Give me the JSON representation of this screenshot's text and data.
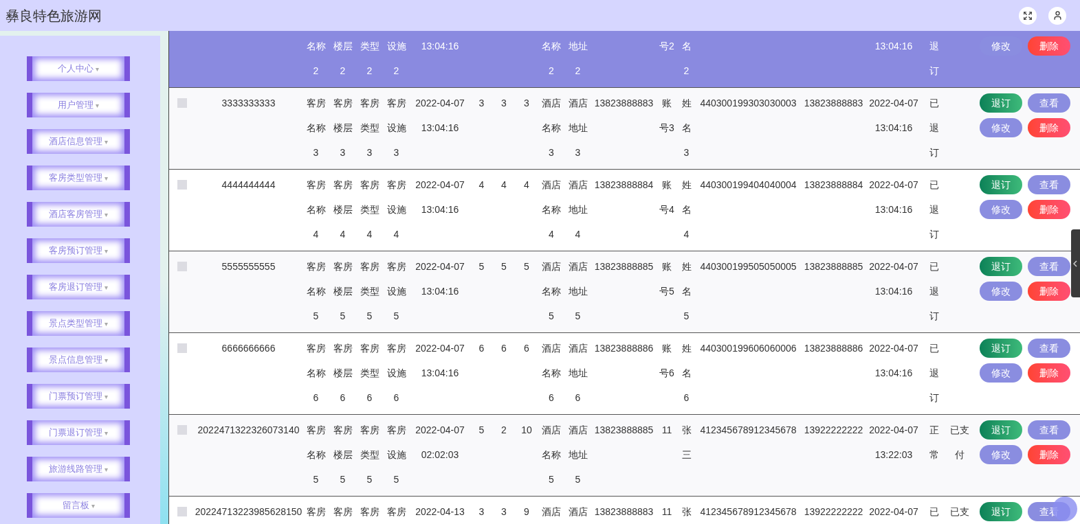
{
  "header": {
    "title": "彝良特色旅游网"
  },
  "sidebar": {
    "items": [
      {
        "label": "个人中心",
        "caret": "▾"
      },
      {
        "label": "用户管理",
        "caret": "▾"
      },
      {
        "label": "酒店信息管理",
        "caret": "▾"
      },
      {
        "label": "客房类型管理",
        "caret": "▾"
      },
      {
        "label": "酒店客房管理",
        "caret": "▾"
      },
      {
        "label": "客房预订管理",
        "caret": "▾"
      },
      {
        "label": "客房退订管理",
        "caret": "▾"
      },
      {
        "label": "景点类型管理",
        "caret": "▾"
      },
      {
        "label": "景点信息管理",
        "caret": "▾"
      },
      {
        "label": "门票预订管理",
        "caret": "▾"
      },
      {
        "label": "门票退订管理",
        "caret": "▾"
      },
      {
        "label": "旅游线路管理",
        "caret": "▾"
      },
      {
        "label": "留言板",
        "caret": "▾"
      }
    ]
  },
  "table": {
    "rows": [
      {
        "highlighted": true,
        "cells": {
          "column_3": "名称2",
          "column_4": "楼层2",
          "column_5": "类型2",
          "column_6": "设施2",
          "column_7": "13:04:16",
          "column_11": "名称2",
          "column_12": "地址2",
          "column_14": "号2",
          "column_15": "名2",
          "column_18": "13:04:16",
          "column_19": "退订"
        },
        "actions": [
          {
            "label": "修改",
            "kind": "edit"
          },
          {
            "label": "删除",
            "kind": "delete"
          }
        ]
      },
      {
        "highlighted": false,
        "checked": false,
        "cells": {
          "column_2": "3333333333",
          "column_3": "客房名称3",
          "column_4": "客房楼层3",
          "column_5": "客房类型3",
          "column_6": "客房设施3",
          "column_7": "2022-04-07 13:04:16",
          "column_8": "3",
          "column_9": "3",
          "column_10": "3",
          "column_11": "酒店名称3",
          "column_12": "酒店地址3",
          "column_13": "13823888883",
          "column_14": "账号3",
          "column_15": "姓名3",
          "column_16": "440300199303030003",
          "column_17": "13823888883",
          "column_18": "2022-04-07 13:04:16",
          "column_19": "已退订"
        },
        "actions": [
          {
            "label": "退订",
            "kind": "refund"
          },
          {
            "label": "查看",
            "kind": "view"
          },
          {
            "label": "修改",
            "kind": "edit"
          },
          {
            "label": "删除",
            "kind": "delete"
          }
        ]
      },
      {
        "highlighted": false,
        "checked": false,
        "cells": {
          "column_2": "4444444444",
          "column_3": "客房名称4",
          "column_4": "客房楼层4",
          "column_5": "客房类型4",
          "column_6": "客房设施4",
          "column_7": "2022-04-07 13:04:16",
          "column_8": "4",
          "column_9": "4",
          "column_10": "4",
          "column_11": "酒店名称4",
          "column_12": "酒店地址4",
          "column_13": "13823888884",
          "column_14": "账号4",
          "column_15": "姓名4",
          "column_16": "440300199404040004",
          "column_17": "13823888884",
          "column_18": "2022-04-07 13:04:16",
          "column_19": "已退订"
        },
        "actions": [
          {
            "label": "退订",
            "kind": "refund"
          },
          {
            "label": "查看",
            "kind": "view"
          },
          {
            "label": "修改",
            "kind": "edit"
          },
          {
            "label": "删除",
            "kind": "delete"
          }
        ]
      },
      {
        "highlighted": false,
        "checked": false,
        "cells": {
          "column_2": "5555555555",
          "column_3": "客房名称5",
          "column_4": "客房楼层5",
          "column_5": "客房类型5",
          "column_6": "客房设施5",
          "column_7": "2022-04-07 13:04:16",
          "column_8": "5",
          "column_9": "5",
          "column_10": "5",
          "column_11": "酒店名称5",
          "column_12": "酒店地址5",
          "column_13": "13823888885",
          "column_14": "账号5",
          "column_15": "姓名5",
          "column_16": "440300199505050005",
          "column_17": "13823888885",
          "column_18": "2022-04-07 13:04:16",
          "column_19": "已退订"
        },
        "actions": [
          {
            "label": "退订",
            "kind": "refund"
          },
          {
            "label": "查看",
            "kind": "view"
          },
          {
            "label": "修改",
            "kind": "edit"
          },
          {
            "label": "删除",
            "kind": "delete"
          }
        ]
      },
      {
        "highlighted": false,
        "checked": false,
        "cells": {
          "column_2": "6666666666",
          "column_3": "客房名称6",
          "column_4": "客房楼层6",
          "column_5": "客房类型6",
          "column_6": "客房设施6",
          "column_7": "2022-04-07 13:04:16",
          "column_8": "6",
          "column_9": "6",
          "column_10": "6",
          "column_11": "酒店名称6",
          "column_12": "酒店地址6",
          "column_13": "13823888886",
          "column_14": "账号6",
          "column_15": "姓名6",
          "column_16": "440300199606060006",
          "column_17": "13823888886",
          "column_18": "2022-04-07 13:04:16",
          "column_19": "已退订"
        },
        "actions": [
          {
            "label": "退订",
            "kind": "refund"
          },
          {
            "label": "查看",
            "kind": "view"
          },
          {
            "label": "修改",
            "kind": "edit"
          },
          {
            "label": "删除",
            "kind": "delete"
          }
        ]
      },
      {
        "highlighted": false,
        "checked": false,
        "cells": {
          "column_2": "2022471322326073140",
          "column_3": "客房名称5",
          "column_4": "客房楼层5",
          "column_5": "客房类型5",
          "column_6": "客房设施5",
          "column_7": "2022-04-07 02:02:03",
          "column_8": "5",
          "column_9": "2",
          "column_10": "10",
          "column_11": "酒店名称5",
          "column_12": "酒店地址5",
          "column_13": "13823888885",
          "column_14": "11",
          "column_15": "张三",
          "column_16": "412345678912345678",
          "column_17": "13922222222",
          "column_18": "2022-04-07 13:22:03",
          "column_19": "正常",
          "column_20": "已支付"
        },
        "actions": [
          {
            "label": "退订",
            "kind": "refund"
          },
          {
            "label": "查看",
            "kind": "view"
          },
          {
            "label": "修改",
            "kind": "edit"
          },
          {
            "label": "删除",
            "kind": "delete"
          }
        ]
      },
      {
        "highlighted": false,
        "checked": false,
        "cells": {
          "column_2": "20224713223985628150",
          "column_3": "客房",
          "column_4": "客房",
          "column_5": "客房",
          "column_6": "客房",
          "column_7": "2022-04-13",
          "column_8": "3",
          "column_9": "3",
          "column_10": "9",
          "column_11": "酒店",
          "column_12": "酒店",
          "column_13": "13823888883",
          "column_14": "11",
          "column_15": "张",
          "column_16": "412345678912345678",
          "column_17": "13922222222",
          "column_18": "2022-04-07",
          "column_19": "已",
          "column_20": "已支"
        },
        "actions": [
          {
            "label": "退订",
            "kind": "refund"
          },
          {
            "label": "查看",
            "kind": "view"
          }
        ]
      }
    ]
  }
}
